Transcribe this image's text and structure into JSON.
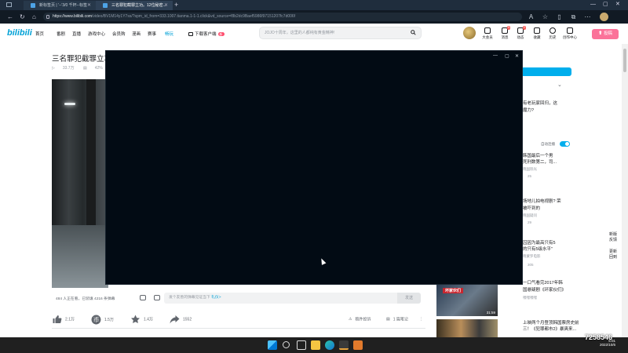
{
  "browser": {
    "tabs": [
      {
        "label": "新标签页 | '--'3/0 千杯--标签"
      },
      {
        "label": "三名罪犯截罪立功。12位秘密..."
      }
    ],
    "url_host": "https://www.bilibili.com",
    "url_path": "/video/BV1M14y1Y7ss/?spm_id_from=333.1007.tianma.1-1-1.click&vd_source=f8b2dc9Baef5986f97151207fc7d006f"
  },
  "header": {
    "logo": "bilibili",
    "nav": [
      "首页",
      "番剧",
      "直播",
      "游戏中心",
      "会员购",
      "漫画",
      "赛事",
      "畅玩",
      "下载客户端"
    ],
    "download_badge": "新",
    "search_placeholder": "JOJO十周年，这里的人都纯有黄金精神!",
    "icons": [
      {
        "label": "大会员",
        "badge": ""
      },
      {
        "label": "消息",
        "badge": "9"
      },
      {
        "label": "动态",
        "badge": "2"
      },
      {
        "label": "收藏",
        "badge": ""
      },
      {
        "label": "历史",
        "badge": ""
      },
      {
        "label": "创作中心",
        "badge": ""
      }
    ],
    "upload": "投稿"
  },
  "video": {
    "title": "三名罪犯截罪立功",
    "meta": [
      "33.7万",
      "42%"
    ],
    "viewers": "484 人正在看，已装填 4216 条弹幕",
    "danmaku_placeholder": "发个友善的弹幕见证当下",
    "danmaku_link": "礼仪>",
    "send": "发送",
    "toolbar": {
      "like": "2.1万",
      "coin": "1.5万",
      "fav": "1.4万",
      "share": "1552",
      "report": "稿件投诉",
      "notes": "1 篇笔记"
    }
  },
  "right": {
    "texts": [
      "有老玩家回归，这",
      "魔力?",
      "韩国最后一个男",
      "死刑数第二，司...",
      "场地儿拍电视剧? 荣",
      "被吓到的",
      "囚因为最高只有5",
      "的只有5级水平\"",
      "一口气看完2017年韩",
      "国悬疑剧《环家伙们》",
      "上映两个月登顶韩国票房史前",
      "三！《犯罪都市2》暴爽来..."
    ],
    "subs": [
      "晓国际光",
      "25",
      "晓国疑问",
      "29",
      "晓蒙罗电影",
      "305",
      "嘿嘿嘿嘿"
    ],
    "autoplay": "自动连播",
    "thumb_duration": "31:59",
    "thumb_banner": "坏家伙们",
    "farright": [
      "新版",
      "反馈",
      "更新",
      "回到"
    ]
  },
  "overlay_number": "7258546",
  "tray": {
    "time": "5:01",
    "date": "2022/10/6"
  }
}
